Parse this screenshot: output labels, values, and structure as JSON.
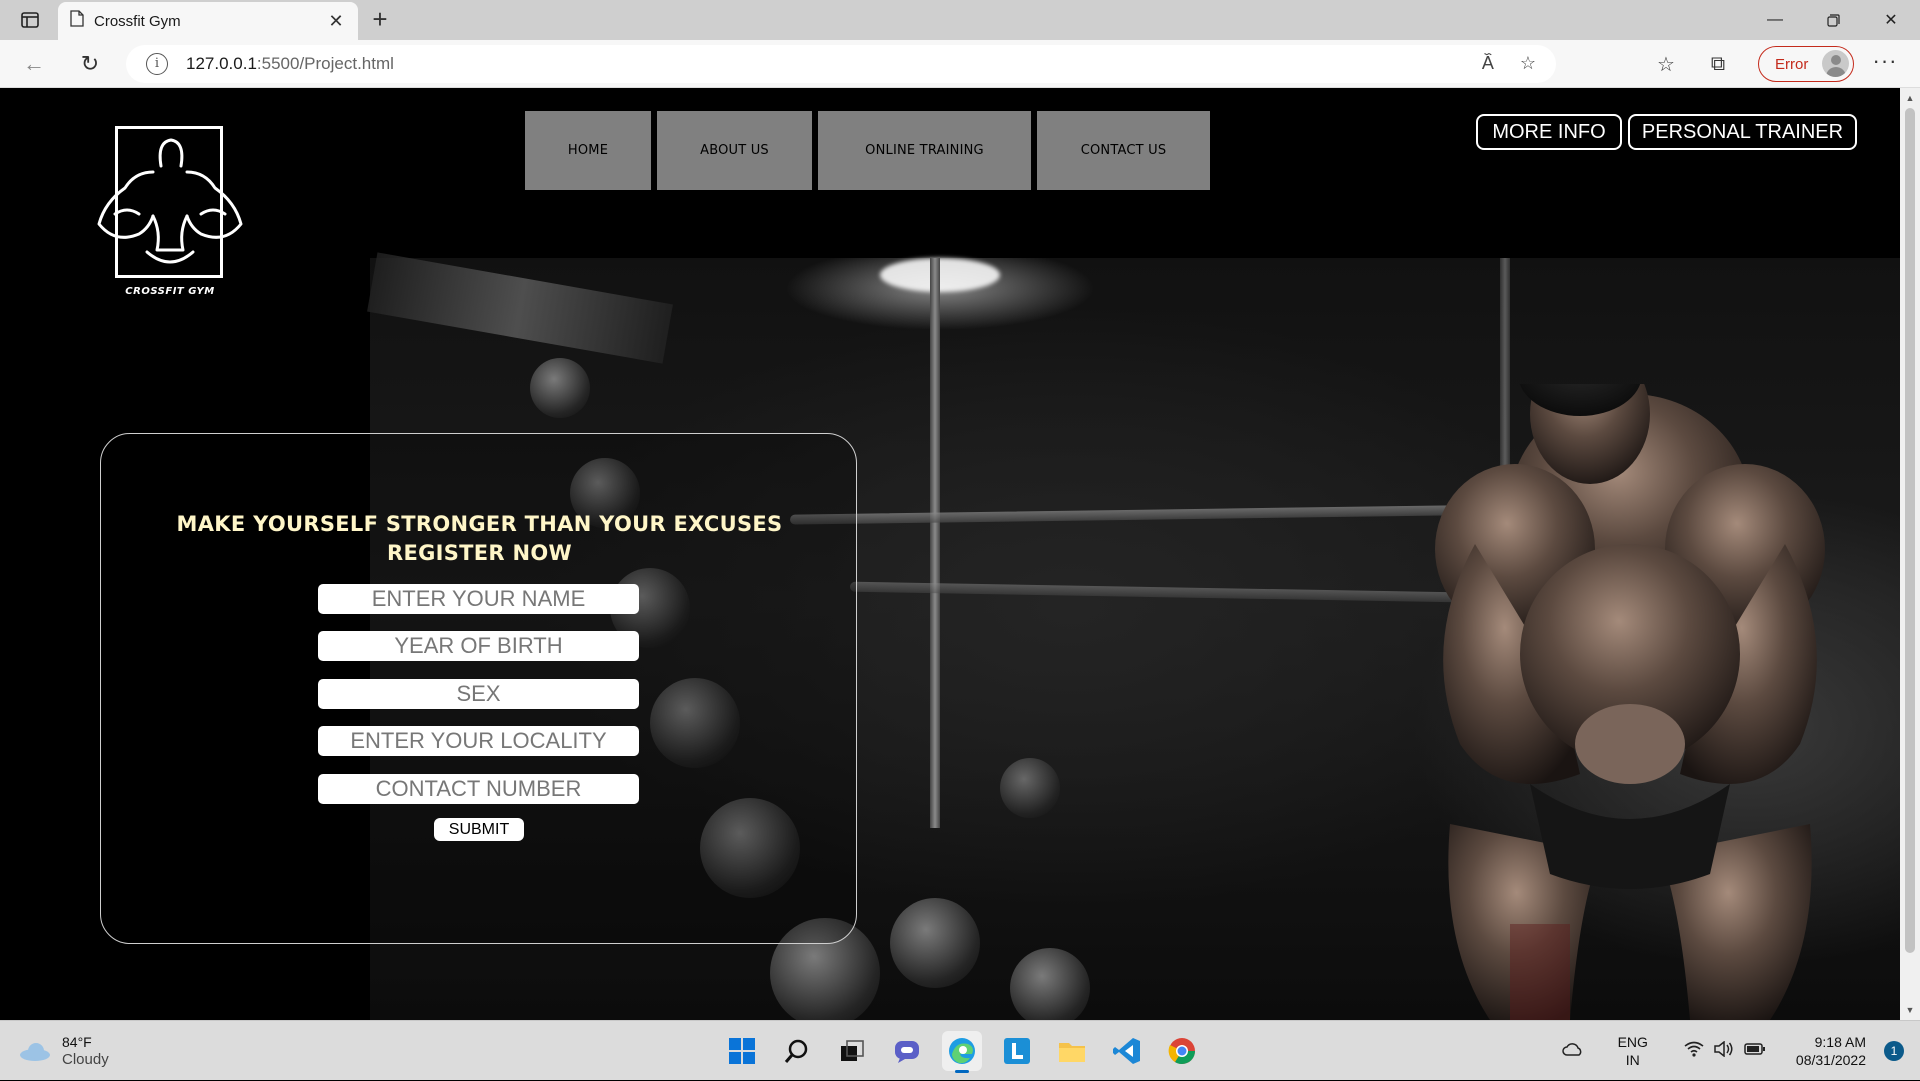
{
  "browser": {
    "tab_title": "Crossfit Gym",
    "url_host": "127.0.0.1",
    "url_path": ":5500/Project.html",
    "profile_status": "Error"
  },
  "site": {
    "logo_text": "CROSSFIT GYM",
    "nav": [
      {
        "label": "HOME"
      },
      {
        "label": "ABOUT US"
      },
      {
        "label": "ONLINE TRAINING"
      },
      {
        "label": "CONTACT US"
      }
    ],
    "more_info_label": "MORE INFO",
    "personal_trainer_label": "PERSONAL TRAINER"
  },
  "form": {
    "heading_line1": "MAKE YOURSELF STRONGER THAN YOUR EXCUSES",
    "heading_line2": "REGISTER NOW",
    "fields": [
      {
        "placeholder": "ENTER YOUR NAME"
      },
      {
        "placeholder": "YEAR OF BIRTH"
      },
      {
        "placeholder": "SEX"
      },
      {
        "placeholder": "ENTER YOUR LOCALITY"
      },
      {
        "placeholder": "CONTACT NUMBER"
      }
    ],
    "submit_label": "SUBMIT"
  },
  "taskbar": {
    "weather_temp": "84°F",
    "weather_desc": "Cloudy",
    "lang_line1": "ENG",
    "lang_line2": "IN",
    "time": "9:18 AM",
    "date": "08/31/2022",
    "notification_count": "1"
  }
}
